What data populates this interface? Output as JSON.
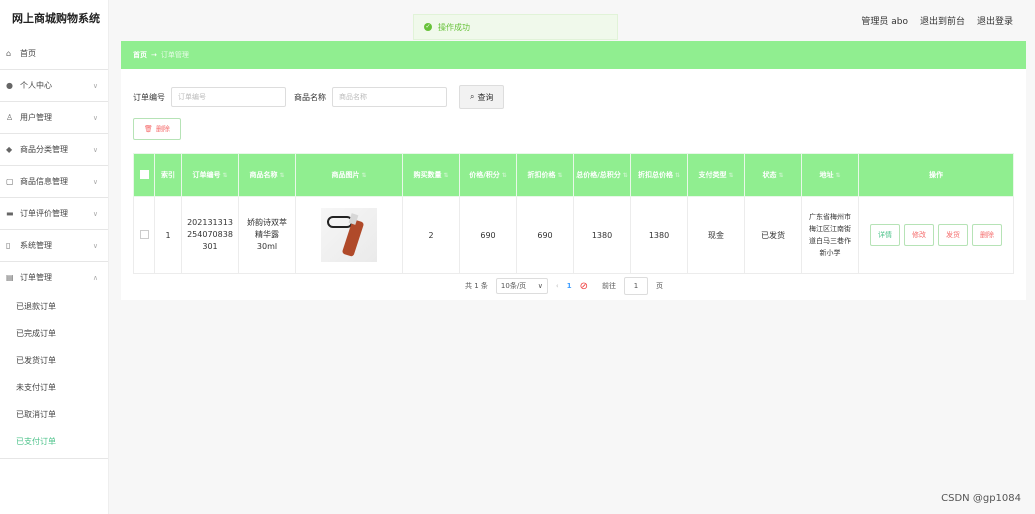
{
  "app": {
    "title": "网上商城购物系统"
  },
  "header": {
    "user": "管理员 abo",
    "to_front": "退出到前台",
    "logout": "退出登录"
  },
  "toast": {
    "message": "操作成功"
  },
  "sidebar": {
    "items": [
      {
        "label": "首页",
        "icon": "home-icon"
      },
      {
        "label": "个人中心",
        "icon": "user-icon"
      },
      {
        "label": "用户管理",
        "icon": "users-icon"
      },
      {
        "label": "商品分类管理",
        "icon": "tag-icon"
      },
      {
        "label": "商品信息管理",
        "icon": "box-icon"
      },
      {
        "label": "订单评价管理",
        "icon": "comment-icon"
      },
      {
        "label": "系统管理",
        "icon": "settings-icon"
      },
      {
        "label": "订单管理",
        "icon": "order-icon"
      }
    ],
    "subitems": [
      "已退款订单",
      "已完成订单",
      "已发货订单",
      "未支付订单",
      "已取消订单",
      "已支付订单"
    ]
  },
  "breadcrumb": {
    "home": "首页",
    "arrow": "→",
    "current": "订单管理"
  },
  "search": {
    "order_label": "订单编号",
    "order_placeholder": "订单编号",
    "product_label": "商品名称",
    "product_placeholder": "商品名称",
    "query_button": "查询"
  },
  "toolbar": {
    "delete_label": "删除"
  },
  "table": {
    "headers": [
      "索引",
      "订单编号",
      "商品名称",
      "商品图片",
      "购买数量",
      "价格/积分",
      "折扣价格",
      "总价格/总积分",
      "折扣总价格",
      "支付类型",
      "状态",
      "地址",
      "操作"
    ],
    "row": {
      "index": "1",
      "order_no": "202131313254070838301",
      "product": "娇韵诗双萃精华露30ml",
      "qty": "2",
      "price": "690",
      "discount_price": "690",
      "total": "1380",
      "discount_total": "1380",
      "pay_type": "现金",
      "status": "已发货",
      "address": "广东省梅州市梅江区江南街道白马三巷作新小学"
    },
    "ops": [
      "详情",
      "修改",
      "发货",
      "删除"
    ]
  },
  "pager": {
    "total": "共 1 条",
    "size": "10条/页",
    "page": "1",
    "goto": "前往",
    "goto_value": "1",
    "unit": "页"
  },
  "watermark": "CSDN @gp1084",
  "colors": {
    "accent": "#90ee90",
    "link": "#409eff",
    "danger": "#f56c6c",
    "success": "#67c23a"
  }
}
